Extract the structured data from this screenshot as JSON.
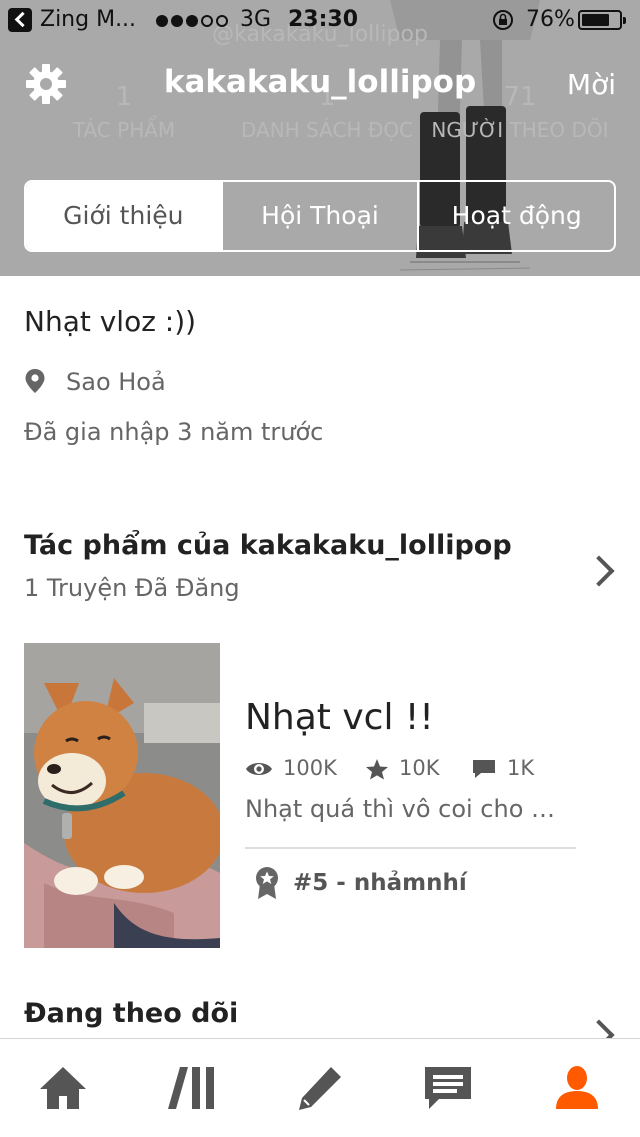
{
  "status_bar": {
    "carrier": "Zing M...",
    "network": "3G",
    "time": "23:30",
    "battery_percent": "76%",
    "battery_level": 0.76
  },
  "profile": {
    "username": "kakakaku_lollipop",
    "handle": "@kakakaku_lollipop",
    "invite_label": "Mời",
    "stats": [
      {
        "value": "1",
        "label": "TÁC PHẨM"
      },
      {
        "value": "1",
        "label": "DANH SÁCH ĐỌC"
      },
      {
        "value": "71",
        "label": "NGƯỜI THEO DÕI"
      }
    ]
  },
  "tabs": [
    {
      "label": "Giới thiệu",
      "active": true
    },
    {
      "label": "Hội Thoại",
      "active": false
    },
    {
      "label": "Hoạt động",
      "active": false
    }
  ],
  "about": {
    "bio": "Nhạt vloz :))",
    "location": "Sao Hoả",
    "joined": "Đã gia nhập 3 năm trước"
  },
  "works": {
    "title": "Tác phẩm của kakakaku_lollipop",
    "subtitle": "1 Truyện Đã Đăng",
    "story": {
      "title": "Nhạt vcl !!",
      "views": "100K",
      "votes": "10K",
      "comments": "1K",
      "description": "Nhạt quá thì vô coi cho mặn",
      "rank": "#5 - nhảmnhí"
    }
  },
  "following": {
    "title": "Đang theo dõi"
  },
  "tabbar": {
    "items": [
      "home-icon",
      "library-icon",
      "write-icon",
      "messages-icon",
      "profile-icon"
    ],
    "active_color": "#ff5a00",
    "inactive_color": "#555555"
  }
}
